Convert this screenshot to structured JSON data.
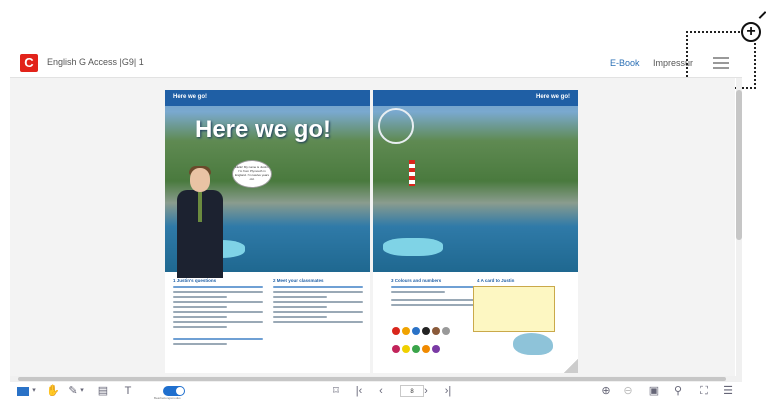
{
  "app": {
    "logo_letter": "C",
    "title": "English G Access |G9| 1",
    "nav": {
      "ebook": "E-Book",
      "impressum": "Impressum"
    },
    "accent": "#e2231a",
    "link_color": "#2a6fb5"
  },
  "book": {
    "left_page": {
      "band_label": "Here we go!",
      "headline": "Here we go!",
      "speech_bubble": "Hello! My name is Justin. I'm from Plymouth in England. I'm twelve years old.",
      "columns": [
        {
          "head": "1 Justin's questions"
        },
        {
          "head": "2 Meet your classmates"
        }
      ]
    },
    "right_page": {
      "band_label": "Here we go!",
      "columns": [
        {
          "head": "3 Colours and numbers"
        },
        {
          "head": "4 A card to Justin"
        }
      ]
    }
  },
  "toolbar": {
    "toggle_label": "Bearbeitungsmodus",
    "page_number": "8",
    "icons": [
      "color-swatch-icon",
      "hand-icon",
      "pen-icon",
      "note-icon",
      "text-icon",
      "toggle-icon",
      "bookmark-icon",
      "first-page-icon",
      "prev-page-icon",
      "next-page-icon",
      "last-page-icon",
      "zoom-in-icon",
      "zoom-out-icon",
      "fit-page-icon",
      "search-icon",
      "fullscreen-icon",
      "list-icon"
    ]
  }
}
